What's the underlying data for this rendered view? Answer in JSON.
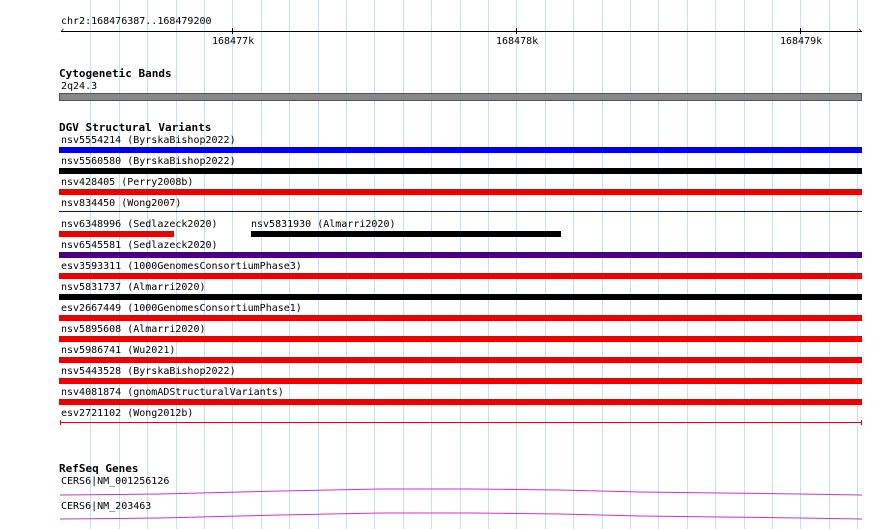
{
  "ruler": {
    "range_label": "chr2:168476387..168479200",
    "ticks": [
      "168477k",
      "168478k",
      "168479k"
    ]
  },
  "tracks": {
    "cytoband": {
      "title": "Cytogenetic Bands",
      "band_label": "2q24.3",
      "color": "#888888"
    },
    "dgv": {
      "title": "DGV Structural Variants",
      "features": [
        {
          "label": "nsv5554214 (ByrskaBishop2022)",
          "color": "#0000ee"
        },
        {
          "label": "nsv5560580 (ByrskaBishop2022)",
          "color": "#000000"
        },
        {
          "label": "nsv428405 (Perry2008b)",
          "color": "#ee0000"
        },
        {
          "label": "nsv834450 (Wong2007)",
          "color": "#0000ee"
        },
        {
          "label": "nsv6348996 (Sedlazeck2020)",
          "color": "#ee0000"
        },
        {
          "label": "nsv5831930 (Almarri2020)",
          "color": "#000000"
        },
        {
          "label": "nsv6545581 (Sedlazeck2020)",
          "color": "#4b0082"
        },
        {
          "label": "esv3593311 (1000GenomesConsortiumPhase3)",
          "color": "#ee0000"
        },
        {
          "label": "nsv5831737 (Almarri2020)",
          "color": "#000000"
        },
        {
          "label": "esv2667449 (1000GenomesConsortiumPhase1)",
          "color": "#ee0000"
        },
        {
          "label": "nsv5895608 (Almarri2020)",
          "color": "#ee0000"
        },
        {
          "label": "nsv5986741 (Wu2021)",
          "color": "#ee0000"
        },
        {
          "label": "nsv5443528 (ByrskaBishop2022)",
          "color": "#ee0000"
        },
        {
          "label": "nsv4081874 (gnomADStructuralVariants)",
          "color": "#ee0000"
        },
        {
          "label": "esv2721102 (Wong2012b)",
          "color": "#ee0000"
        }
      ]
    },
    "refseq": {
      "title": "RefSeq Genes",
      "transcripts": [
        {
          "label": "CERS6|NM_001256126"
        },
        {
          "label": "CERS6|NM_203463"
        }
      ],
      "color": "#cc33cc"
    }
  }
}
